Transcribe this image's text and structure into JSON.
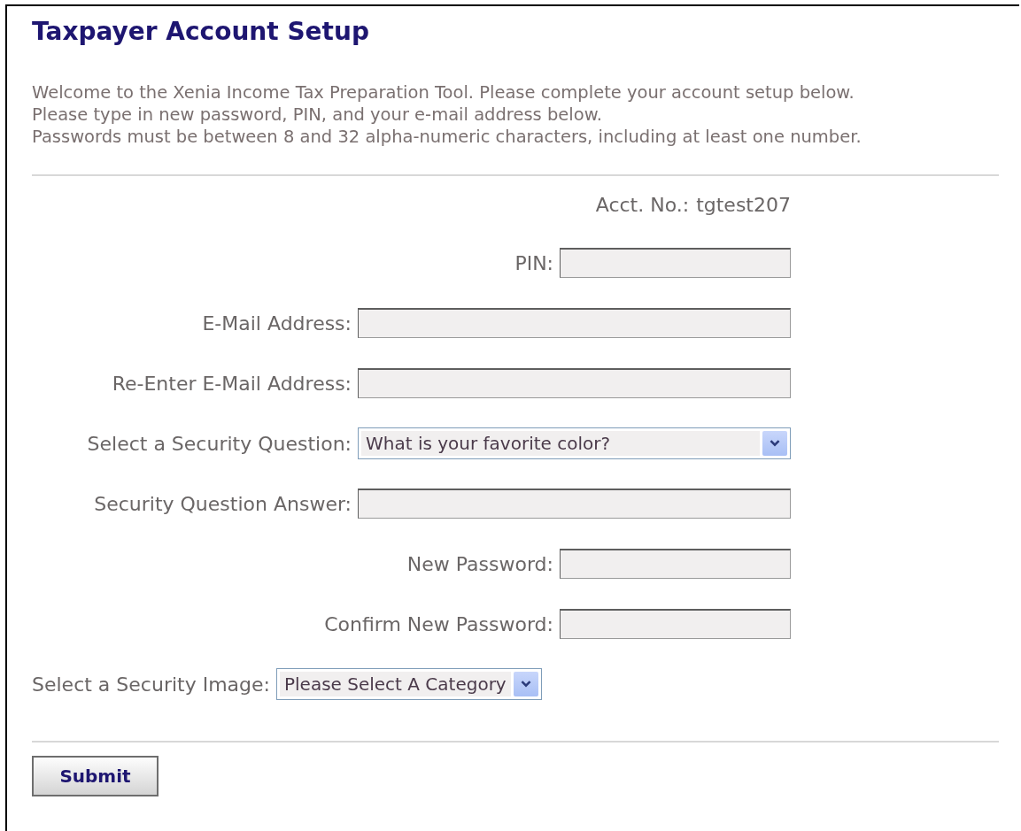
{
  "title": "Taxpayer Account Setup",
  "intro": [
    "Welcome to the Xenia Income Tax Preparation Tool. Please complete your account setup below.",
    "Please type in new password, PIN, and your e-mail address below.",
    "Passwords must be between 8 and 32 alpha-numeric characters, including at least one number."
  ],
  "account": {
    "label": "Acct. No.:",
    "value": "tgtest207"
  },
  "fields": [
    {
      "kind": "short-input",
      "label": "PIN:"
    },
    {
      "kind": "long-input",
      "label": "E-Mail Address:"
    },
    {
      "kind": "long-input",
      "label": "Re-Enter E-Mail Address:"
    },
    {
      "kind": "select",
      "label": "Select a Security Question:",
      "value": "What is your favorite color?"
    },
    {
      "kind": "long-input",
      "label": "Security Question Answer:"
    },
    {
      "kind": "short-input",
      "label": "New Password:"
    },
    {
      "kind": "short-input",
      "label": "Confirm New Password:"
    },
    {
      "kind": "image-select",
      "label": "Select a Security Image:",
      "value": "Please Select A Category"
    }
  ],
  "submit": "Submit"
}
